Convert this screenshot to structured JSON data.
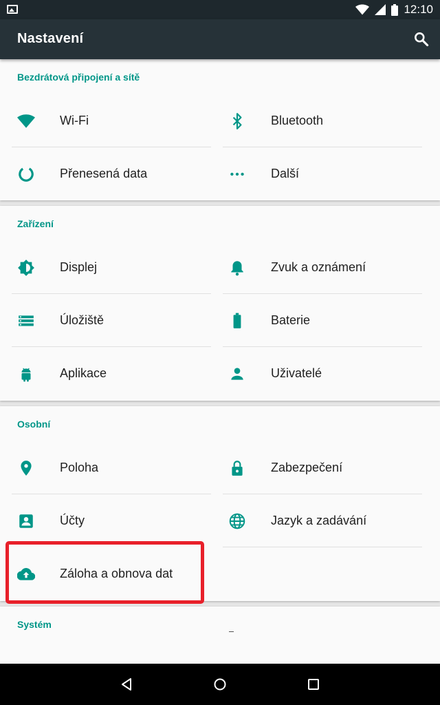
{
  "status_bar": {
    "time": "12:10"
  },
  "app_bar": {
    "title": "Nastavení"
  },
  "sections": [
    {
      "title": "Bezdrátová připojení a sítě",
      "items": [
        {
          "label": "Wi-Fi",
          "icon": "wifi-icon"
        },
        {
          "label": "Bluetooth",
          "icon": "bluetooth-icon"
        },
        {
          "label": "Přenesená data",
          "icon": "data-usage-icon"
        },
        {
          "label": "Další",
          "icon": "more-icon"
        }
      ]
    },
    {
      "title": "Zařízení",
      "items": [
        {
          "label": "Displej",
          "icon": "brightness-icon"
        },
        {
          "label": "Zvuk a oznámení",
          "icon": "bell-icon"
        },
        {
          "label": "Úložiště",
          "icon": "storage-icon"
        },
        {
          "label": "Baterie",
          "icon": "battery-icon"
        },
        {
          "label": "Aplikace",
          "icon": "android-icon"
        },
        {
          "label": "Uživatelé",
          "icon": "person-icon"
        }
      ]
    },
    {
      "title": "Osobní",
      "items": [
        {
          "label": "Poloha",
          "icon": "location-icon"
        },
        {
          "label": "Zabezpečení",
          "icon": "lock-icon"
        },
        {
          "label": "Účty",
          "icon": "account-box-icon"
        },
        {
          "label": "Jazyk a zadávání",
          "icon": "globe-icon"
        },
        {
          "label": "Záloha a obnova dat",
          "icon": "cloud-upload-icon"
        }
      ]
    },
    {
      "title": "Systém",
      "items": []
    }
  ],
  "colors": {
    "accent": "#009688",
    "app_bar": "#263238",
    "status_bar": "#1e282d",
    "highlight": "#e8202a"
  }
}
